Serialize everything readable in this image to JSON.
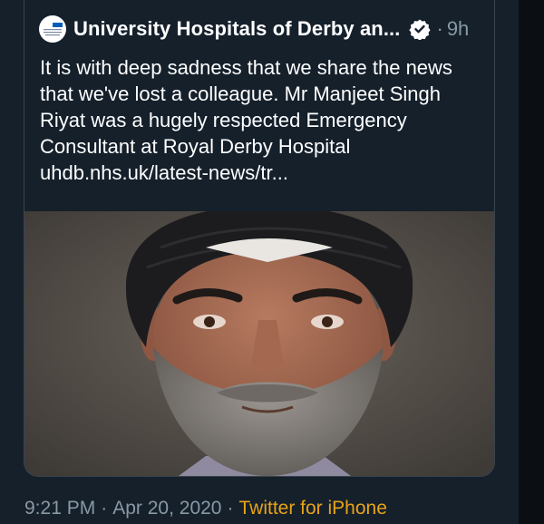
{
  "tweet": {
    "author_name": "University Hospitals of Derby an...",
    "separator": "·",
    "relative_time": "9h",
    "text": "It is with deep sadness that we share the news that we've lost a colleague. Mr Manjeet Singh Riyat was a hugely respected Emergency Consultant at Royal Derby Hospital uhdb.nhs.uk/latest-news/tr...",
    "avatar_icon": "nhs-logo-icon",
    "verified_icon": "verified-badge-icon",
    "photo": "portrait-photo"
  },
  "meta": {
    "time": "9:21 PM",
    "date": "Apr 20, 2020",
    "separator": "·",
    "source": "Twitter for iPhone"
  },
  "colors": {
    "background": "#15202b",
    "secondary_text": "#8899a6",
    "source_link": "#e8a317",
    "border": "#38444d"
  }
}
